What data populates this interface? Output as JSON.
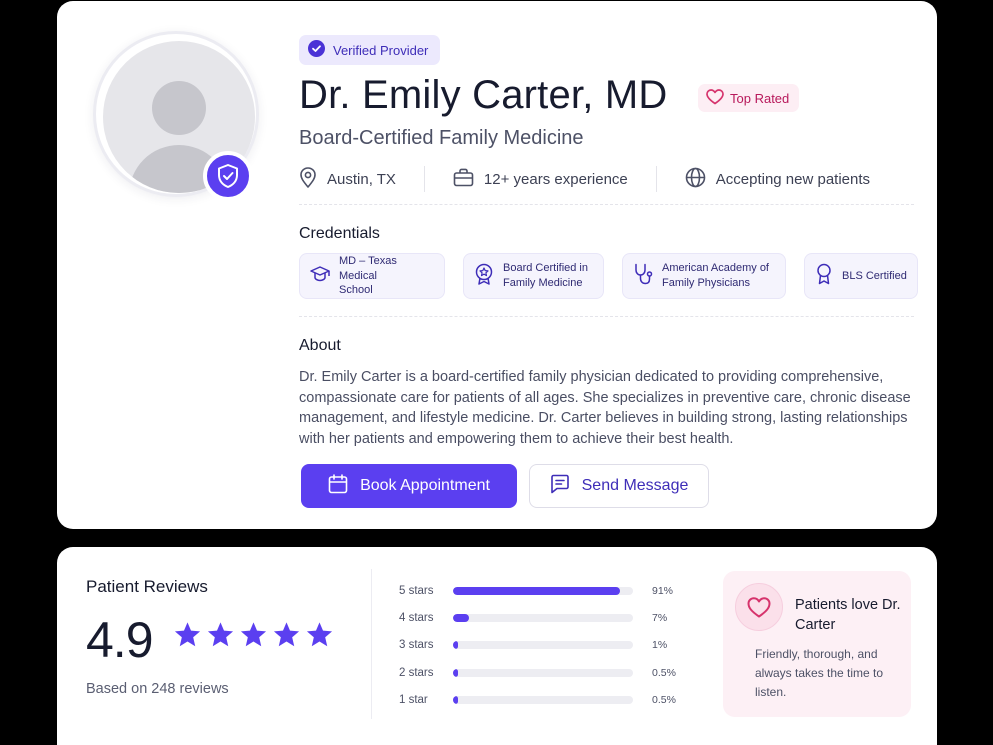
{
  "profile": {
    "verified_label": "Verified Provider",
    "name": "Dr. Emily Carter, MD",
    "top_rated_label": "Top Rated",
    "specialty": "Board-Certified Family Medicine",
    "meta": {
      "location": "Austin, TX",
      "experience": "12+ years experience",
      "availability": "Accepting new patients"
    },
    "credentials_title": "Credentials",
    "credentials": [
      {
        "label": "MD – Texas Medical\nSchool",
        "icon": "graduation-cap-icon"
      },
      {
        "label": "Board Certified in\nFamily Medicine",
        "icon": "badge-star-icon"
      },
      {
        "label": "American Academy of\nFamily Physicians",
        "icon": "stethoscope-icon"
      },
      {
        "label": "BLS Certified",
        "icon": "award-ribbon-icon"
      }
    ],
    "about_title": "About",
    "about_text": "Dr. Emily Carter is a board-certified family physician dedicated to providing comprehensive, compassionate care for patients of all ages. She specializes in preventive care, chronic disease management, and lifestyle medicine. Dr. Carter believes in building strong, lasting relationships with her patients and empowering them to achieve their best health.",
    "book_label": "Book Appointment",
    "message_label": "Send Message"
  },
  "reviews": {
    "title": "Patient Reviews",
    "score": "4.9",
    "star_count": 5,
    "based_on": "Based on 248 reviews",
    "distribution": [
      {
        "label": "5 stars",
        "pct": "91%",
        "fill": 0.93
      },
      {
        "label": "4 stars",
        "pct": "7%",
        "fill": 0.09
      },
      {
        "label": "3 stars",
        "pct": "1%",
        "fill": 0.03
      },
      {
        "label": "2 stars",
        "pct": "0.5%",
        "fill": 0.03
      },
      {
        "label": "1 star",
        "pct": "0.5%",
        "fill": 0.03
      }
    ],
    "highlight": {
      "title": "Patients love Dr. Carter",
      "text": "Friendly, thorough, and always takes the time to listen."
    }
  },
  "colors": {
    "accent": "#5b3ff0",
    "pink": "#d6336c",
    "background": "#000000"
  }
}
